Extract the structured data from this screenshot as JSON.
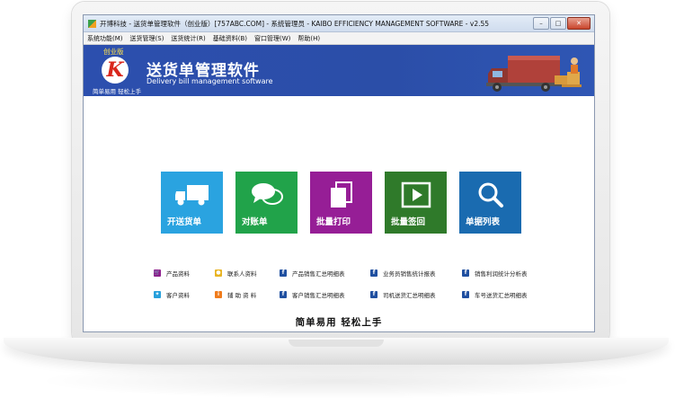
{
  "window": {
    "title": "开博科技 - 送货单管理软件（创业版）[757ABC.COM] - 系统管理员 - KAIBO EFFICIENCY MANAGEMENT SOFTWARE - v2.55",
    "controls": {
      "minimize": "–",
      "maximize": "□",
      "close": "✕"
    }
  },
  "menu": [
    {
      "label": "系统功能(M)"
    },
    {
      "label": "送货管理(S)"
    },
    {
      "label": "送货统计(R)"
    },
    {
      "label": "基础资料(B)"
    },
    {
      "label": "窗口管理(W)"
    },
    {
      "label": "帮助(H)"
    }
  ],
  "banner": {
    "edition": "创业版",
    "logo_letter": "K",
    "slogan_small": "简单易用 轻松上手",
    "app_name_cn": "送货单管理软件",
    "app_name_en": "Delivery bill management software"
  },
  "tiles": [
    {
      "label": "开送货单",
      "color": "#2aa3e0",
      "icon": "truck-icon"
    },
    {
      "label": "对账单",
      "color": "#21a34a",
      "icon": "chat-bubbles-icon"
    },
    {
      "label": "批量打印",
      "color": "#961e96",
      "icon": "documents-icon"
    },
    {
      "label": "批量签回",
      "color": "#2f7a2a",
      "icon": "play-icon"
    },
    {
      "label": "单据列表",
      "color": "#1a6bb0",
      "icon": "magnifier-icon"
    }
  ],
  "links": {
    "row1": [
      {
        "label": "产品资料",
        "color": "#8e1f8e",
        "icon": "cart-icon",
        "glyph": ""
      },
      {
        "label": "联系人资料",
        "color": "#e8b423",
        "icon": "contacts-icon",
        "glyph": ""
      },
      {
        "label": "产品销售汇总明细表",
        "color": "#1f4fa0",
        "icon": "report-icon",
        "glyph": "f"
      },
      {
        "label": "业务员销售统计报表",
        "color": "#1f4fa0",
        "icon": "report-icon",
        "glyph": "f"
      },
      {
        "label": "销售利润统计分析表",
        "color": "#1f4fa0",
        "icon": "report-icon",
        "glyph": "f"
      }
    ],
    "row2": [
      {
        "label": "客户资料",
        "color": "#27a0dc",
        "icon": "bird-icon",
        "glyph": ""
      },
      {
        "label": "辅 助 资 料",
        "color": "#f07c1c",
        "icon": "info-icon",
        "glyph": "i"
      },
      {
        "label": "客户销售汇总明细表",
        "color": "#1f4fa0",
        "icon": "report-icon",
        "glyph": "f"
      },
      {
        "label": "司机送货汇总明细表",
        "color": "#1f4fa0",
        "icon": "report-icon",
        "glyph": "f"
      },
      {
        "label": "车号送货汇总明细表",
        "color": "#1f4fa0",
        "icon": "report-icon",
        "glyph": "f"
      }
    ]
  },
  "footer": {
    "slogan": "简单易用 轻松上手"
  }
}
